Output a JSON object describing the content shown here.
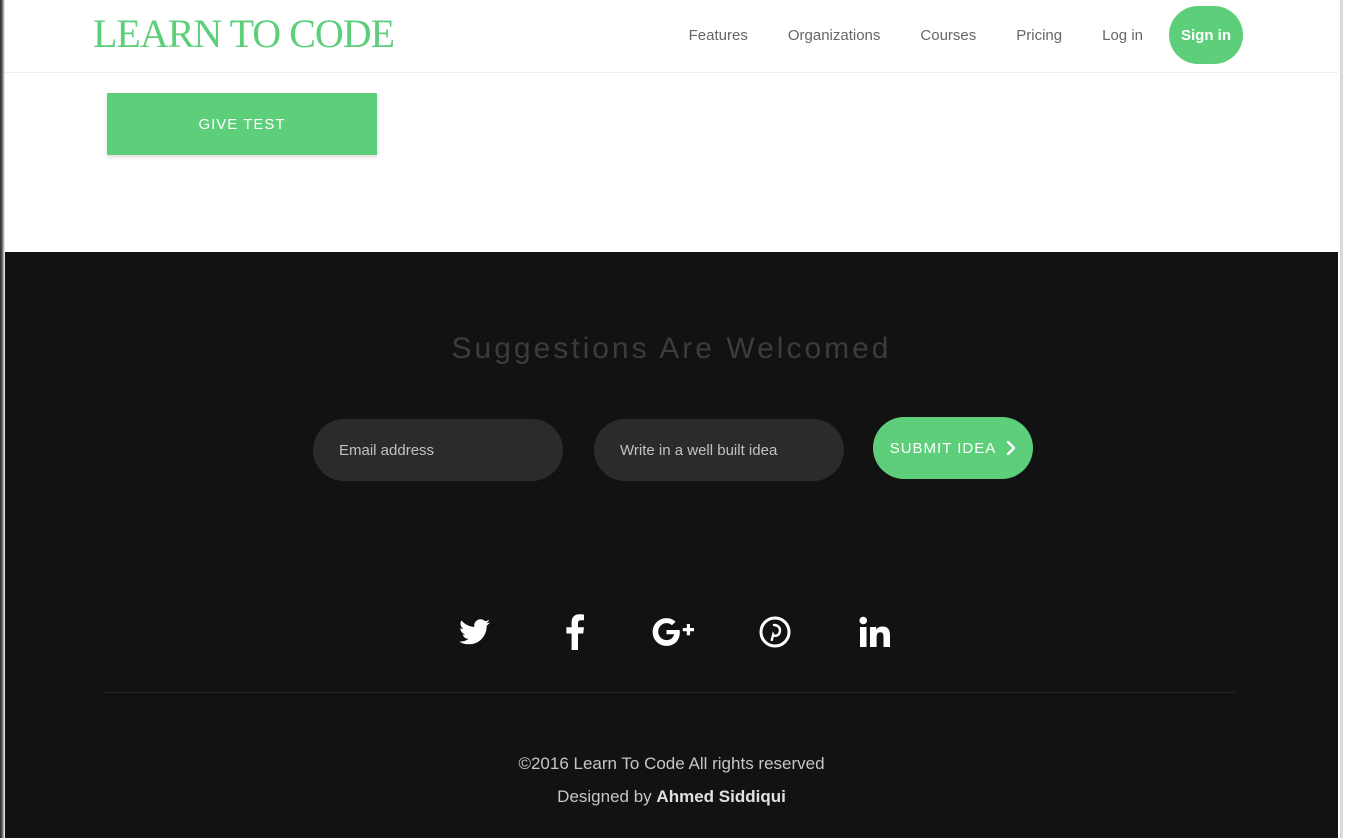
{
  "header": {
    "logo": "LEARN TO CODE",
    "nav": [
      "Features",
      "Organizations",
      "Courses",
      "Pricing",
      "Log in"
    ],
    "signup_label": "Sign in"
  },
  "content": {
    "cta_label": "GIVE TEST"
  },
  "footer": {
    "title": "Suggestions Are Welcomed",
    "email_placeholder": "Email address",
    "suggestion_placeholder": "Write in a well built idea",
    "submit_label": "SUBMIT IDEA",
    "socials": [
      "twitter-icon",
      "facebook-icon",
      "google-plus-icon",
      "pinterest-icon",
      "linkedin-icon"
    ],
    "copyright": "©2016 Learn To Code All rights reserved",
    "designed_prefix": "Designed by",
    "designer": "Ahmed Siddiqui"
  },
  "colors": {
    "accent": "#5dcf7a",
    "footer_bg": "#121212",
    "field_bg": "#2b2b2b"
  }
}
